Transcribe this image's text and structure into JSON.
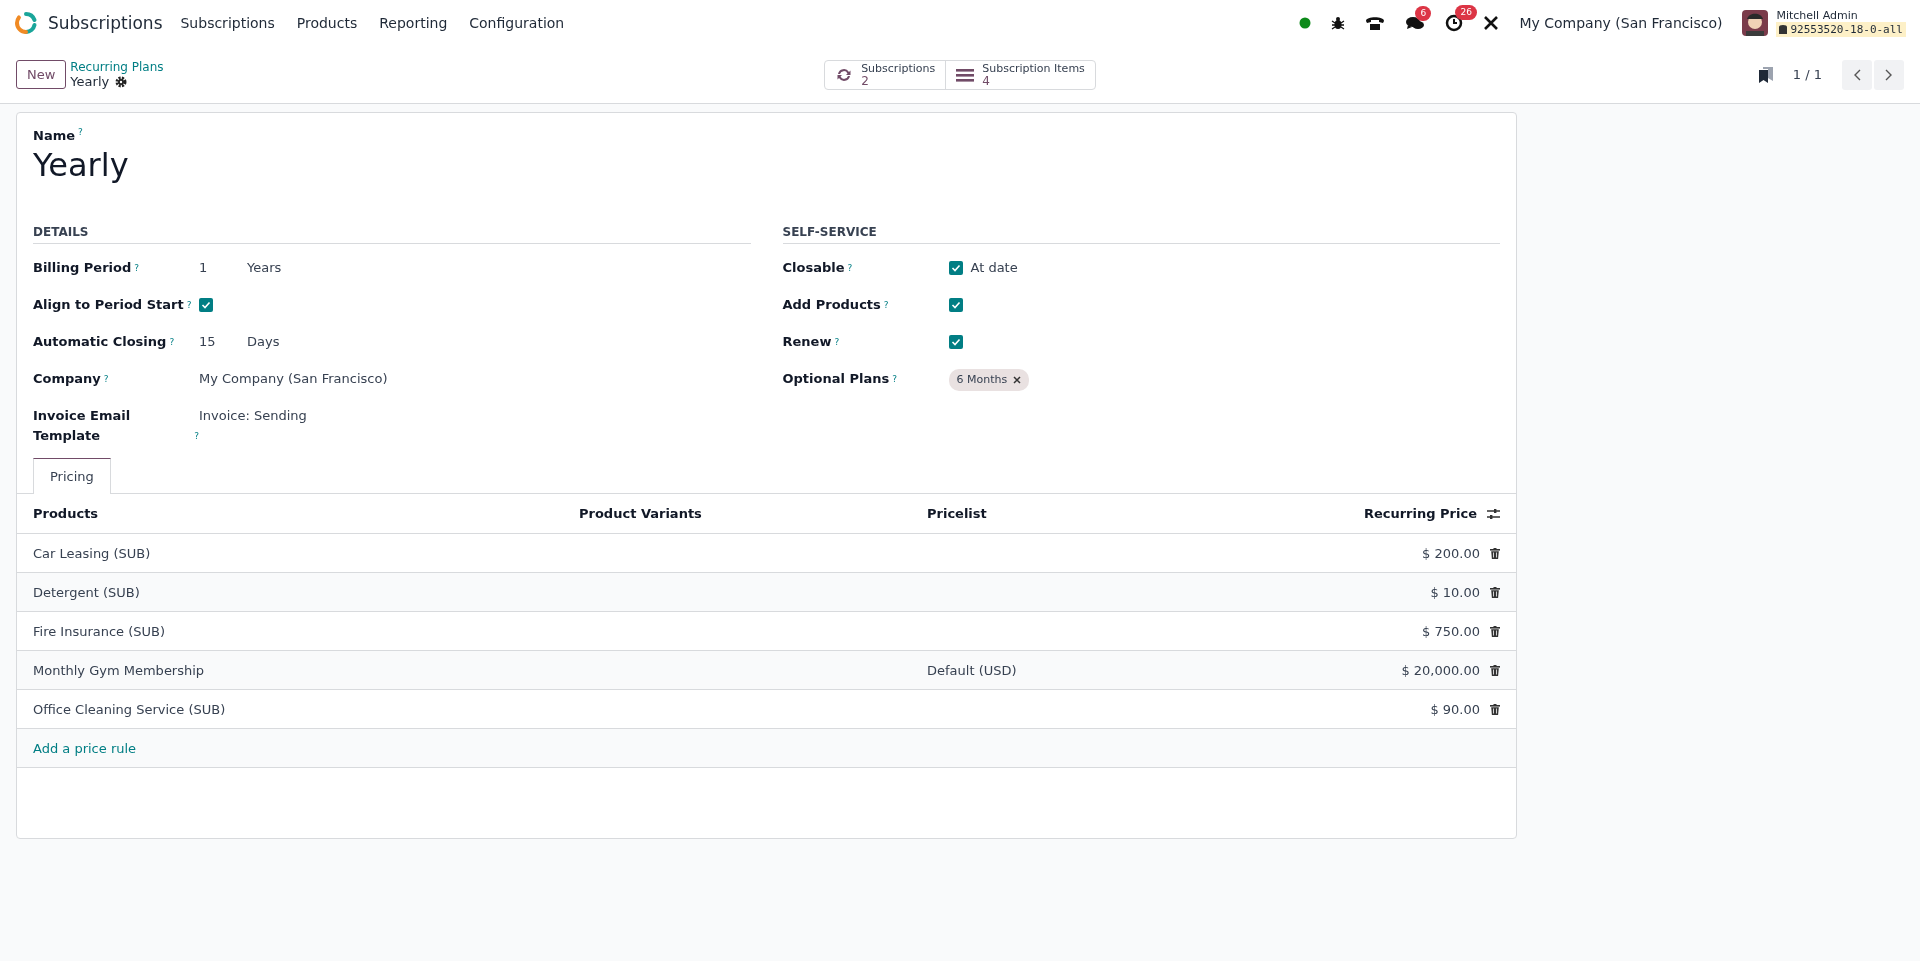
{
  "navbar": {
    "app_name": "Subscriptions",
    "menus": [
      "Subscriptions",
      "Products",
      "Reporting",
      "Configuration"
    ],
    "messages_count": "6",
    "activities_count": "26",
    "company": "My Company (San Francisco)",
    "user": {
      "name": "Mitchell Admin",
      "database": "92553520-18-0-all"
    }
  },
  "control_panel": {
    "new_button": "New",
    "breadcrumb": "Recurring Plans",
    "record": "Yearly",
    "smart_buttons": [
      {
        "kind": "refresh",
        "label": "Subscriptions",
        "count": "2"
      },
      {
        "kind": "list",
        "label": "Subscription Items",
        "count": "4"
      }
    ],
    "pager": "1 / 1"
  },
  "form": {
    "name_label": "Name",
    "help_mark": "?",
    "name": "Yearly",
    "groups": [
      {
        "title": "DETAILS",
        "fields": [
          {
            "kind": "number_unit",
            "label": "Billing Period",
            "value": "1",
            "unit": "Years"
          },
          {
            "kind": "checkbox",
            "label": "Align to Period Start",
            "checked": true
          },
          {
            "kind": "number_unit",
            "label": "Automatic Closing",
            "value": "15",
            "unit": "Days"
          },
          {
            "kind": "text",
            "label": "Company",
            "value": "My Company (San Francisco)"
          },
          {
            "kind": "text",
            "label": "Invoice Email Template",
            "value": "Invoice: Sending"
          }
        ]
      },
      {
        "title": "SELF-SERVICE",
        "fields": [
          {
            "kind": "checkbox",
            "label": "Closable",
            "checked": true,
            "caption": "At date"
          },
          {
            "kind": "checkbox",
            "label": "Add Products",
            "checked": true
          },
          {
            "kind": "checkbox",
            "label": "Renew",
            "checked": true
          },
          {
            "kind": "tags",
            "label": "Optional Plans",
            "tags": [
              "6 Months"
            ]
          }
        ]
      }
    ],
    "tabs": [
      {
        "label": "Pricing",
        "selected": true
      }
    ],
    "table": {
      "columns": [
        "Products",
        "Product Variants",
        "Pricelist",
        "Recurring Price"
      ],
      "rows": [
        {
          "product": "Car Leasing (SUB)",
          "pricelist": "",
          "price": "$ 200.00"
        },
        {
          "product": "Detergent (SUB)",
          "pricelist": "",
          "price": "$ 10.00"
        },
        {
          "product": "Fire Insurance (SUB)",
          "pricelist": "",
          "price": "$ 750.00"
        },
        {
          "product": "Monthly Gym Membership",
          "pricelist": "Default (USD)",
          "price": "$ 20,000.00"
        },
        {
          "product": "Office Cleaning Service (SUB)",
          "pricelist": "",
          "price": "$ 90.00"
        }
      ],
      "add_line": "Add a price rule"
    }
  }
}
